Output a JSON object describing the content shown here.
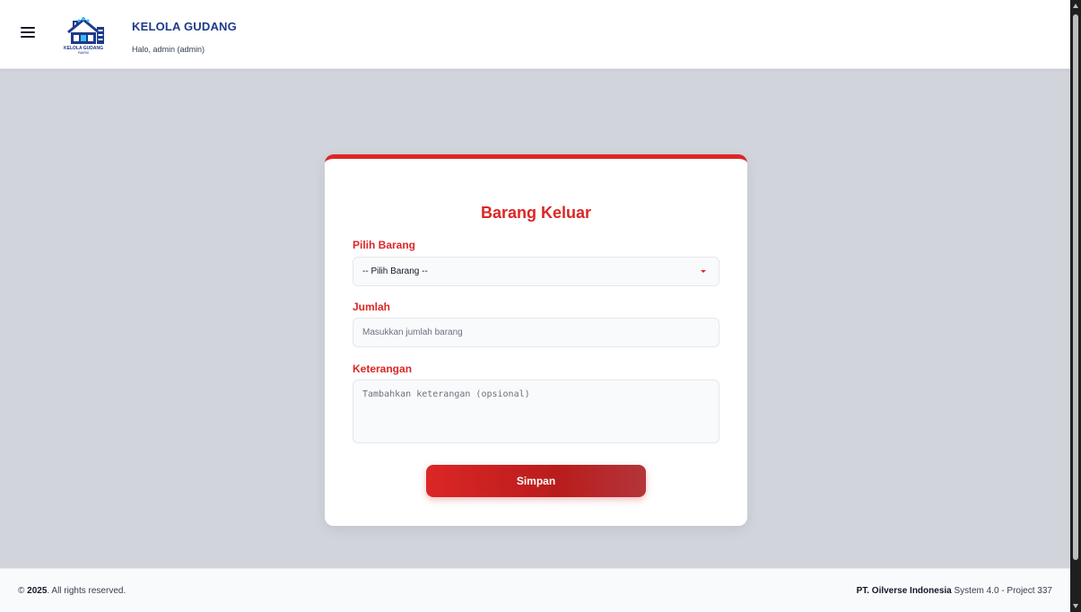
{
  "header": {
    "title": "KELOLA GUDANG",
    "greeting": "Halo, admin (admin)",
    "logo_text": "KELOLA GUDANG",
    "logo_subtext": "PABRIK",
    "menu_icon": "hamburger-icon"
  },
  "form": {
    "title": "Barang Keluar",
    "item_label": "Pilih Barang",
    "item_selected": "-- Pilih Barang --",
    "qty_label": "Jumlah",
    "qty_placeholder": "Masukkan jumlah barang",
    "note_label": "Keterangan",
    "note_placeholder": "Tambahkan keterangan (opsional)",
    "submit_label": "Simpan"
  },
  "footer": {
    "copyright_symbol": "©",
    "year": "2025",
    "rights": ". All rights reserved.",
    "company": "PT. Oilverse Indonesia",
    "version": " System 4.0 - Project 337"
  },
  "colors": {
    "accent": "#dc2626",
    "brand": "#1e3a8a",
    "background": "#d1d5db"
  }
}
